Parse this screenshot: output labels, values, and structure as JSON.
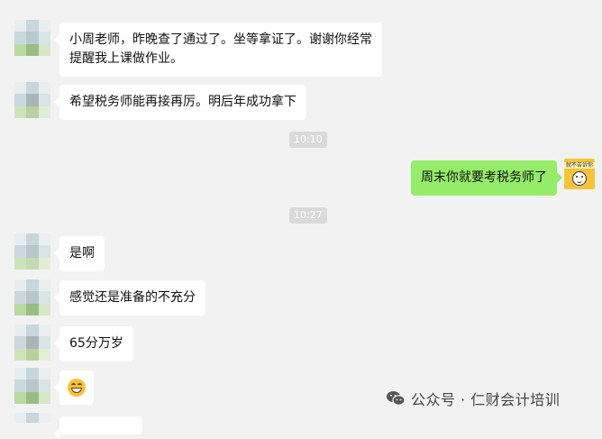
{
  "messages": [
    {
      "side": "left",
      "lines": [
        "小周老师，昨晚查了通过了。坐等拿证了。谢谢你经常",
        "提醒我上课做作业。"
      ]
    },
    {
      "side": "left",
      "lines": [
        "希望税务师能再接再厉。明后年成功拿下"
      ]
    },
    {
      "type": "time",
      "text": "10:10"
    },
    {
      "side": "right",
      "lines": [
        "周末你就要考税务师了"
      ]
    },
    {
      "type": "time",
      "text": "10:27"
    },
    {
      "side": "left",
      "lines": [
        "是啊"
      ]
    },
    {
      "side": "left",
      "lines": [
        "感觉还是准备的不充分"
      ]
    },
    {
      "side": "left",
      "lines": [
        "65分万岁"
      ]
    },
    {
      "side": "left",
      "emoji": "grinning-face-emoji"
    }
  ],
  "self_avatar_text": "就不告诉你",
  "watermark": {
    "text": "公众号 · 仁财会计培训",
    "icon": "wechat-icon"
  },
  "colors": {
    "background": "#f2f2f2",
    "bubble_left": "#ffffff",
    "bubble_right": "#95ec69",
    "timestamp_bg": "#dadada"
  }
}
